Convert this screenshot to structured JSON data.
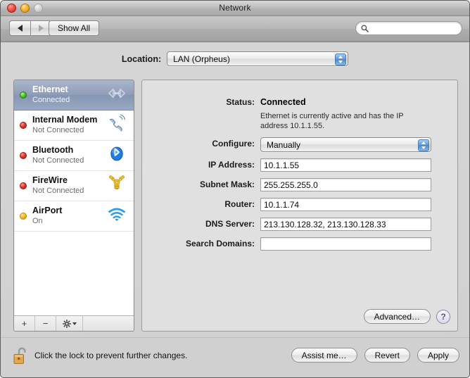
{
  "window": {
    "title": "Network",
    "traffic_lights": [
      "close-button",
      "minimize-button",
      "zoom-button"
    ]
  },
  "toolbar": {
    "back_label": "back-arrow",
    "forward_label": "forward-arrow",
    "show_all_label": "Show All",
    "search": {
      "value": "",
      "placeholder": "",
      "icon": "search-icon"
    }
  },
  "location": {
    "label": "Location:",
    "selected": "LAN (Orpheus)"
  },
  "sidebar": {
    "interfaces": [
      {
        "name": "Ethernet",
        "status": "Connected",
        "dot": "green",
        "icon": "ethernet-icon",
        "selected": true
      },
      {
        "name": "Internal Modem",
        "status": "Not Connected",
        "dot": "red",
        "icon": "modem-icon",
        "selected": false
      },
      {
        "name": "Bluetooth",
        "status": "Not Connected",
        "dot": "red",
        "icon": "bluetooth-icon",
        "selected": false
      },
      {
        "name": "FireWire",
        "status": "Not Connected",
        "dot": "red",
        "icon": "firewire-icon",
        "selected": false
      },
      {
        "name": "AirPort",
        "status": "On",
        "dot": "amber",
        "icon": "airport-wifi-icon",
        "selected": false
      }
    ],
    "toolbar": {
      "add_label": "+",
      "remove_label": "−",
      "actions_label": "gear-icon"
    }
  },
  "detail": {
    "status_label": "Status:",
    "status_value": "Connected",
    "status_description": "Ethernet is currently active and has the IP address 10.1.1.55.",
    "fields": [
      {
        "label": "Configure:",
        "value": "Manually",
        "type": "popup"
      },
      {
        "label": "IP Address:",
        "value": "10.1.1.55",
        "type": "text"
      },
      {
        "label": "Subnet Mask:",
        "value": "255.255.255.0",
        "type": "text"
      },
      {
        "label": "Router:",
        "value": "10.1.1.74",
        "type": "text"
      },
      {
        "label": "DNS Server:",
        "value": "213.130.128.32, 213.130.128.33",
        "type": "text"
      },
      {
        "label": "Search Domains:",
        "value": "",
        "type": "text"
      }
    ],
    "advanced_label": "Advanced…",
    "help_label": "?"
  },
  "bottom": {
    "lock_icon": "unlocked-padlock-icon",
    "lock_text": "Click the lock to prevent further changes.",
    "assist_label": "Assist me…",
    "revert_label": "Revert",
    "apply_label": "Apply"
  },
  "colors": {
    "selection": "#8e9db7",
    "connected_dot": "#4cc72a",
    "disconnected_dot": "#e0352a",
    "on_dot": "#f5bb1c",
    "stepper_blue": "#5a97d8"
  }
}
